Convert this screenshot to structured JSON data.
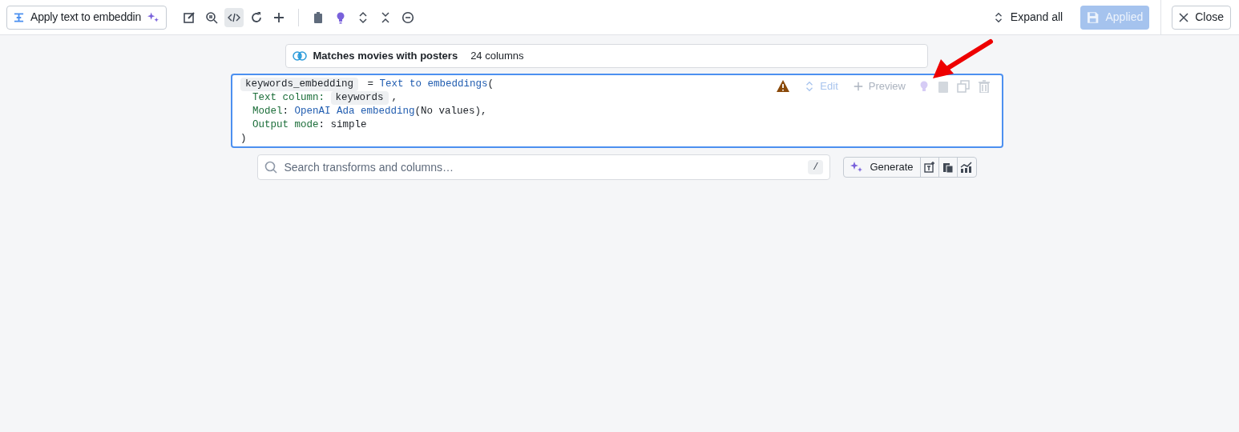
{
  "toolbar": {
    "title_field": "Apply text to embeddin",
    "tool_buttons": [
      {
        "selected": false
      },
      {
        "selected": false
      },
      {
        "selected": true
      },
      {
        "selected": false
      },
      {
        "selected": false
      },
      {
        "selected": false
      },
      {
        "selected": false
      },
      {
        "selected": false
      },
      {
        "selected": false
      },
      {
        "selected": false
      }
    ],
    "expand_all": "Expand all",
    "applied": {
      "label": "Applied",
      "disabled": true
    },
    "close": "Close"
  },
  "input_node": {
    "name": "Matches movies with posters",
    "columns": "24 columns"
  },
  "transform": {
    "actions": [
      {
        "label": "Edit",
        "disabled": true
      },
      {
        "label": "Preview",
        "disabled": true
      }
    ],
    "code_lines": [
      [
        {
          "kind": "chip",
          "text": "keywords_embedding"
        },
        {
          "kind": "plain",
          "text": " = "
        },
        {
          "kind": "func",
          "text": "Text to embeddings"
        },
        {
          "kind": "plain",
          "text": "("
        }
      ],
      [
        {
          "kind": "param",
          "text": "  Text column: "
        },
        {
          "kind": "chip",
          "text": "keywords"
        },
        {
          "kind": "plain",
          "text": ","
        }
      ],
      [
        {
          "kind": "param",
          "text": "  Model"
        },
        {
          "kind": "plain",
          "text": ": "
        },
        {
          "kind": "func",
          "text": "OpenAI Ada embedding"
        },
        {
          "kind": "plain",
          "text": "(No values),"
        }
      ],
      [
        {
          "kind": "param",
          "text": "  Output mode"
        },
        {
          "kind": "plain",
          "text": ": simple"
        }
      ],
      [
        {
          "kind": "plain",
          "text": ")"
        }
      ]
    ]
  },
  "search": {
    "placeholder": "Search transforms and columns…",
    "shortcut": "/"
  },
  "generate": "Generate"
}
